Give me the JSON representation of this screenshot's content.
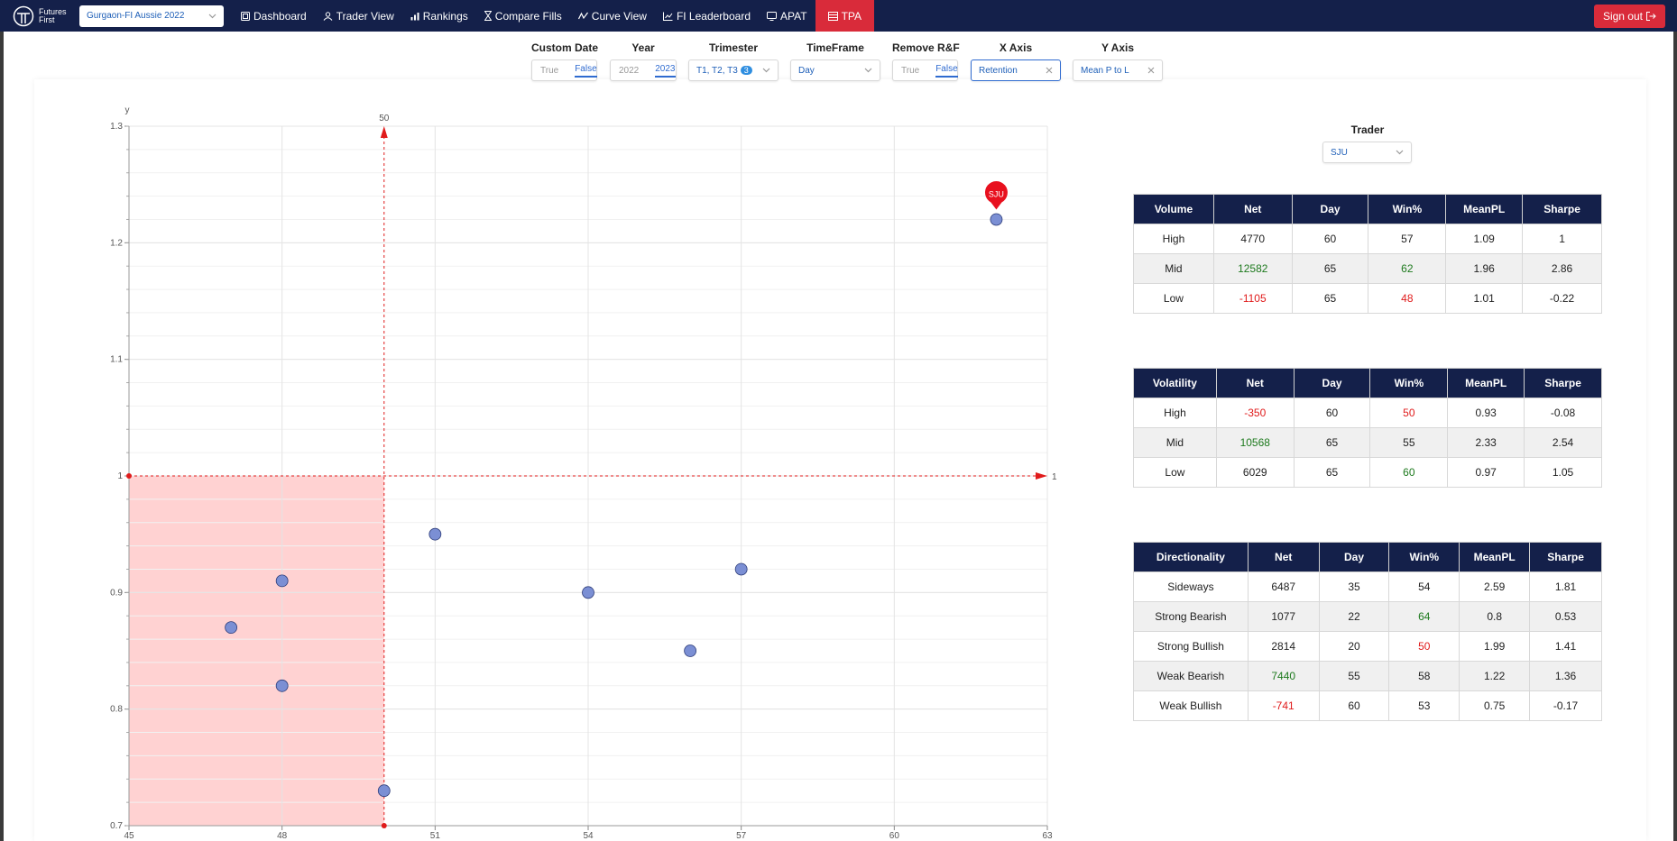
{
  "app": {
    "brand_line1": "Futures",
    "brand_line2": "First",
    "workspace": "Gurgaon-FI Aussie 2022",
    "nav": [
      {
        "label": "Dashboard",
        "icon": "dashboard-icon"
      },
      {
        "label": "Trader View",
        "icon": "trader-view-icon"
      },
      {
        "label": "Rankings",
        "icon": "rankings-icon"
      },
      {
        "label": "Compare Fills",
        "icon": "hourglass-icon"
      },
      {
        "label": "Curve View",
        "icon": "curve-icon"
      },
      {
        "label": "FI Leaderboard",
        "icon": "leaderboard-icon"
      },
      {
        "label": "APAT",
        "icon": "monitor-icon"
      },
      {
        "label": "TPA",
        "icon": "table-icon",
        "active": true
      }
    ],
    "signout": "Sign out",
    "accent_color": "#d92b3a",
    "nav_bg": "#14204a"
  },
  "filters": {
    "custom_date": {
      "label": "Custom Date",
      "options": [
        "True",
        "False"
      ],
      "selected": "False"
    },
    "year": {
      "label": "Year",
      "options": [
        "2022",
        "2023"
      ],
      "selected": "2023"
    },
    "trimester": {
      "label": "Trimester",
      "value": "T1, T2, T3",
      "count": "3"
    },
    "timeframe": {
      "label": "TimeFrame",
      "value": "Day"
    },
    "remove_rf": {
      "label": "Remove R&F",
      "options": [
        "True",
        "False"
      ],
      "selected": "False"
    },
    "x_axis": {
      "label": "X Axis",
      "value": "Retention"
    },
    "y_axis": {
      "label": "Y Axis",
      "value": "Mean P to L"
    }
  },
  "chart_data": {
    "type": "scatter",
    "xlabel": "",
    "ylabel": "y",
    "xlim": [
      45,
      63
    ],
    "ylim": [
      0.7,
      1.3
    ],
    "x_ticks": [
      45,
      48,
      51,
      54,
      57,
      60,
      63
    ],
    "y_ticks": [
      0.7,
      0.8,
      0.9,
      1,
      1.1,
      1.2,
      1.3
    ],
    "x_ref": 50,
    "y_ref": 1,
    "x_ref_label": "50",
    "y_ref_label": "1",
    "shaded_quadrant": {
      "x": [
        45,
        50
      ],
      "y": [
        0.7,
        1
      ],
      "color": "#ffd2d2"
    },
    "point_color": "#7b8fd4",
    "points": [
      {
        "x": 47,
        "y": 0.87
      },
      {
        "x": 48,
        "y": 0.91
      },
      {
        "x": 48,
        "y": 0.82
      },
      {
        "x": 50,
        "y": 0.73
      },
      {
        "x": 51,
        "y": 0.95
      },
      {
        "x": 54,
        "y": 0.9
      },
      {
        "x": 56,
        "y": 0.85
      },
      {
        "x": 57,
        "y": 0.92
      },
      {
        "x": 62,
        "y": 1.22,
        "label": "SJU",
        "highlight": true
      }
    ]
  },
  "trader": {
    "label": "Trader",
    "value": "SJU"
  },
  "tables": [
    {
      "headers": [
        "Volume",
        "Net",
        "Day",
        "Win%",
        "MeanPL",
        "Sharpe"
      ],
      "rows": [
        [
          "High",
          "4770",
          "60",
          "57",
          "1.09",
          "1"
        ],
        [
          "Mid",
          "12582",
          "65",
          "62",
          "1.96",
          "2.86"
        ],
        [
          "Low",
          "-1105",
          "65",
          "48",
          "1.01",
          "-0.22"
        ]
      ],
      "colors": [
        [
          "",
          "",
          "",
          "",
          "",
          ""
        ],
        [
          "",
          "g",
          "",
          "g",
          "",
          ""
        ],
        [
          "",
          "r",
          "",
          "r",
          "",
          ""
        ]
      ]
    },
    {
      "headers": [
        "Volatility",
        "Net",
        "Day",
        "Win%",
        "MeanPL",
        "Sharpe"
      ],
      "rows": [
        [
          "High",
          "-350",
          "60",
          "50",
          "0.93",
          "-0.08"
        ],
        [
          "Mid",
          "10568",
          "65",
          "55",
          "2.33",
          "2.54"
        ],
        [
          "Low",
          "6029",
          "65",
          "60",
          "0.97",
          "1.05"
        ]
      ],
      "colors": [
        [
          "",
          "r",
          "",
          "r",
          "",
          ""
        ],
        [
          "",
          "g",
          "",
          "",
          "",
          ""
        ],
        [
          "",
          "",
          "",
          "g",
          "",
          ""
        ]
      ]
    },
    {
      "headers": [
        "Directionality",
        "Net",
        "Day",
        "Win%",
        "MeanPL",
        "Sharpe"
      ],
      "rows": [
        [
          "Sideways",
          "6487",
          "35",
          "54",
          "2.59",
          "1.81"
        ],
        [
          "Strong Bearish",
          "1077",
          "22",
          "64",
          "0.8",
          "0.53"
        ],
        [
          "Strong Bullish",
          "2814",
          "20",
          "50",
          "1.99",
          "1.41"
        ],
        [
          "Weak Bearish",
          "7440",
          "55",
          "58",
          "1.22",
          "1.36"
        ],
        [
          "Weak Bullish",
          "-741",
          "60",
          "53",
          "0.75",
          "-0.17"
        ]
      ],
      "colors": [
        [
          "",
          "",
          "",
          "",
          "",
          ""
        ],
        [
          "",
          "",
          "",
          "g",
          "",
          ""
        ],
        [
          "",
          "",
          "",
          "r",
          "",
          ""
        ],
        [
          "",
          "g",
          "",
          "",
          "",
          ""
        ],
        [
          "",
          "r",
          "",
          "",
          "",
          ""
        ]
      ]
    }
  ]
}
